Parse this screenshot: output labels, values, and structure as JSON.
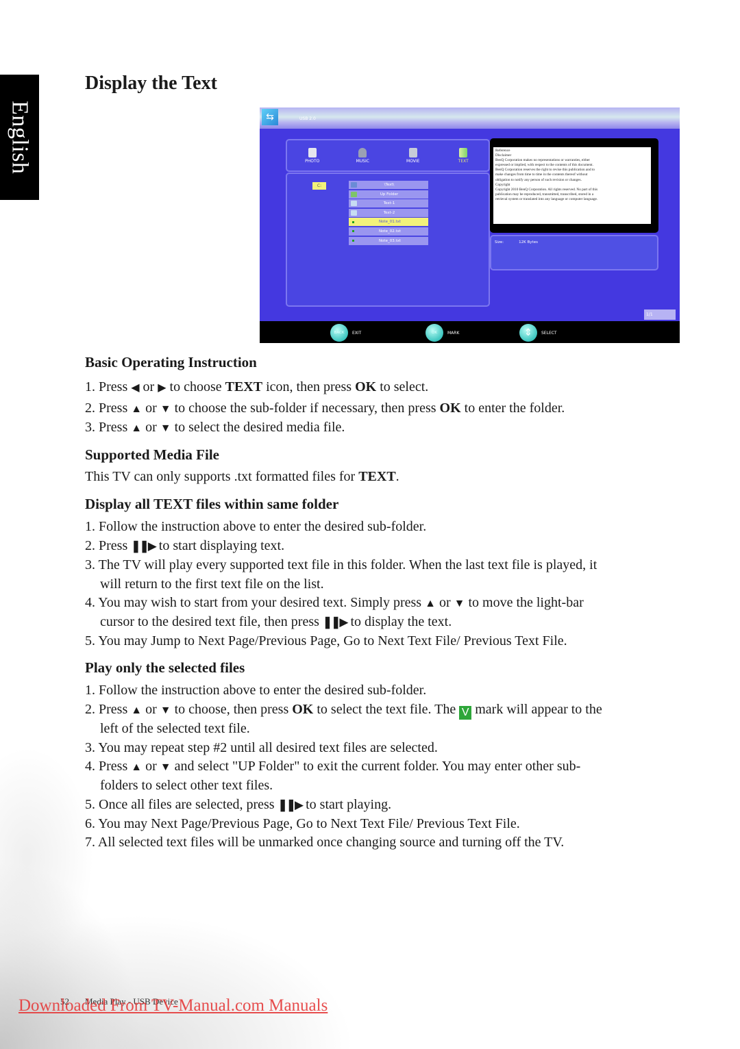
{
  "page": {
    "language_tab": "English",
    "title": "Display the Text",
    "footer_page_number": "52",
    "footer_section": "Media Play - USB Device",
    "watermark": "Downloaded From TV-Manual.com Manuals"
  },
  "tv_screen": {
    "header_label": "USB 2.0",
    "media_tabs": [
      {
        "label": "PHOTO",
        "icon": "camera-icon",
        "active": false
      },
      {
        "label": "MUSIC",
        "icon": "headphones-icon",
        "active": false
      },
      {
        "label": "MOVIE",
        "icon": "video-camera-icon",
        "active": false
      },
      {
        "label": "TEXT",
        "icon": "document-icon",
        "active": true
      }
    ],
    "drive": "C:",
    "files": [
      {
        "name": "\\Text\\",
        "type": "current-folder"
      },
      {
        "name": "Up Folder",
        "type": "up-folder"
      },
      {
        "name": "Text-1",
        "type": "folder"
      },
      {
        "name": "Text-2",
        "type": "folder"
      },
      {
        "name": "Note_01.txt",
        "type": "txt",
        "selected": true
      },
      {
        "name": "Note_02.txt",
        "type": "txt"
      },
      {
        "name": "Note_03.txt",
        "type": "txt"
      }
    ],
    "preview_lines": [
      "Reference",
      "Disclaimer",
      "BenQ Corporation makes no representations or warranties, either",
      "expressed or implied, with respect to the contents of this document.",
      "BenQ Corporation reserves the right to revise this publication and to",
      "make changes from time to time in the contents thereof without",
      "obligation to notify any person of such revision or changes.",
      "Copyright",
      "Copyright 2010 BenQ Corporation. All rights reserved. No part of this",
      "publication may be reproduced, transmitted, transcribed, stored in a",
      "retrieval system or translated into any language or computer language."
    ],
    "info_size_label": "Size:",
    "info_size_value": "12K Bytes",
    "page_counter": "1/1",
    "hints": [
      {
        "button": "BACK",
        "label": "EXIT"
      },
      {
        "button": "OK",
        "label": "MARK"
      },
      {
        "button": "⇕",
        "label": "SELECT"
      }
    ]
  },
  "sections": {
    "basic": {
      "heading": "Basic Operating Instruction",
      "s1": {
        "a": "1. Press ",
        "s1": "◀",
        "b": " or ",
        "s2": "▶",
        "c": " to choose ",
        "d": "TEXT",
        "e": " icon, then press ",
        "f": "OK",
        "g": " to select."
      },
      "s2": {
        "a": "2. Press ",
        "s1": "▲",
        "b": " or ",
        "s2": "▼",
        "c": " to choose the sub-folder if necessary, then press ",
        "d": "OK",
        "e": " to enter the folder."
      },
      "s3": {
        "a": "3. Press ",
        "s1": "▲",
        "b": " or ",
        "s2": "▼",
        "c": " to select the desired media file."
      }
    },
    "supported": {
      "heading": "Supported Media File",
      "text_a": "This TV can only supports .txt formatted files for ",
      "text_b": "TEXT",
      "text_c": "."
    },
    "display_all": {
      "heading": "Display all TEXT files within same folder",
      "s1": "1. Follow the instruction above to enter the desired sub-folder.",
      "s2a": "2. Press ",
      "s2b": " to start displaying text.",
      "s3a": "3. The TV will play every supported text file in this folder. When the last text file is played, it",
      "s3b": "will return to the first text file on the list.",
      "s4a": "4. You may wish to start from your desired text. Simply press ",
      "s4b": " or ",
      "s4c": " to move the light-bar",
      "s4d": "cursor to the desired text file, then press ",
      "s4e": " to display the text.",
      "s5": "5. You may Jump to Next Page/Previous Page,  Go to Next Text File/ Previous Text File."
    },
    "play_selected": {
      "heading": "Play only the selected files",
      "s1": "1. Follow the instruction above to enter the desired sub-folder.",
      "s2a": "2. Press ",
      "s2b": " or ",
      "s2c": " to choose, then press ",
      "s2d": "OK",
      "s2e": " to select the text file. The ",
      "s2f": " mark will appear to the",
      "s2g": "left of the selected text file.",
      "s3": "3. You may repeat step #2 until all desired text files are selected.",
      "s4a": "4. Press ",
      "s4b": " or ",
      "s4c": " and select \"UP Folder\" to exit the current folder. You may enter other sub-",
      "s4d": "folders to select other text files.",
      "s5a": "5. Once all files are selected, press ",
      "s5b": " to start playing.",
      "s6": "6. You may Next Page/Previous Page,  Go to Next Text File/ Previous Text File.",
      "s7": "7. All selected text files will be unmarked once changing source and turning off the TV."
    }
  },
  "symbols": {
    "up": "▲",
    "down": "▼",
    "play_pause": "❚❚▶",
    "v_mark": "V"
  },
  "colors": {
    "tv_blue": "#4438e0",
    "highlight_yellow": "#f2f27a",
    "mark_green": "#2ea63a",
    "watermark_red": "#e53b3b"
  }
}
